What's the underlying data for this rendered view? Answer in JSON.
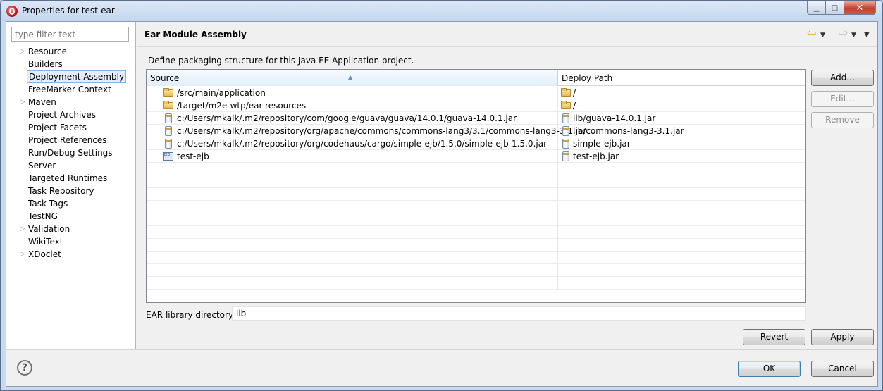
{
  "window": {
    "title": "Properties for test-ear",
    "minimize_glyph": "▁",
    "maximize_glyph": "□",
    "close_glyph": "✕"
  },
  "filter": {
    "placeholder": "type filter text",
    "value": ""
  },
  "pref_tree": [
    {
      "label": "Resource",
      "expandable": true,
      "selected": false
    },
    {
      "label": "Builders",
      "expandable": false,
      "selected": false
    },
    {
      "label": "Deployment Assembly",
      "expandable": false,
      "selected": true
    },
    {
      "label": "FreeMarker Context",
      "expandable": false,
      "selected": false
    },
    {
      "label": "Maven",
      "expandable": true,
      "selected": false
    },
    {
      "label": "Project Archives",
      "expandable": false,
      "selected": false
    },
    {
      "label": "Project Facets",
      "expandable": false,
      "selected": false
    },
    {
      "label": "Project References",
      "expandable": false,
      "selected": false
    },
    {
      "label": "Run/Debug Settings",
      "expandable": false,
      "selected": false
    },
    {
      "label": "Server",
      "expandable": false,
      "selected": false
    },
    {
      "label": "Targeted Runtimes",
      "expandable": false,
      "selected": false
    },
    {
      "label": "Task Repository",
      "expandable": false,
      "selected": false
    },
    {
      "label": "Task Tags",
      "expandable": false,
      "selected": false
    },
    {
      "label": "TestNG",
      "expandable": false,
      "selected": false
    },
    {
      "label": "Validation",
      "expandable": true,
      "selected": false
    },
    {
      "label": "WikiText",
      "expandable": false,
      "selected": false
    },
    {
      "label": "XDoclet",
      "expandable": true,
      "selected": false
    }
  ],
  "page": {
    "title": "Ear Module Assembly",
    "description": "Define packaging structure for this Java EE Application project.",
    "nav": {
      "back": "⇦",
      "forward": "⇨",
      "menu": "▼"
    }
  },
  "table": {
    "columns": {
      "source": "Source",
      "deploy": "Deploy Path"
    },
    "sort_indicator": "▲",
    "rows": [
      {
        "source": "/src/main/application",
        "source_icon": "folder-icon",
        "deploy": "/",
        "deploy_icon": "folder-icon"
      },
      {
        "source": "/target/m2e-wtp/ear-resources",
        "source_icon": "folder-icon",
        "deploy": "/",
        "deploy_icon": "folder-icon"
      },
      {
        "source": "c:/Users/mkalk/.m2/repository/com/google/guava/guava/14.0.1/guava-14.0.1.jar",
        "source_icon": "jar-icon",
        "deploy": "lib/guava-14.0.1.jar",
        "deploy_icon": "jar-icon"
      },
      {
        "source": "c:/Users/mkalk/.m2/repository/org/apache/commons/commons-lang3/3.1/commons-lang3-3.1.jar",
        "source_icon": "jar-icon",
        "deploy": "lib/commons-lang3-3.1.jar",
        "deploy_icon": "jar-icon"
      },
      {
        "source": "c:/Users/mkalk/.m2/repository/org/codehaus/cargo/simple-ejb/1.5.0/simple-ejb-1.5.0.jar",
        "source_icon": "jar-icon",
        "deploy": "simple-ejb.jar",
        "deploy_icon": "jar-icon"
      },
      {
        "source": "test-ejb",
        "source_icon": "ejb-project-icon",
        "deploy": "test-ejb.jar",
        "deploy_icon": "jar-icon"
      }
    ],
    "empty_rows": 10
  },
  "buttons": {
    "add": "Add...",
    "edit": "Edit...",
    "remove": "Remove",
    "revert": "Revert",
    "apply": "Apply",
    "ok": "OK",
    "cancel": "Cancel"
  },
  "ear_library": {
    "label": "EAR library directory:",
    "value": "lib"
  },
  "help": {
    "glyph": "?"
  }
}
